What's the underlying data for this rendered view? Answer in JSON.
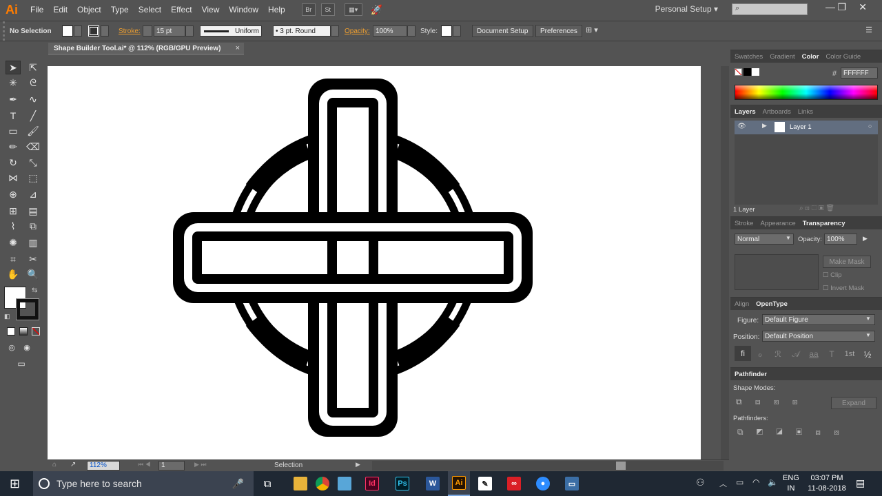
{
  "app": {
    "logo": "Ai",
    "menu": [
      "File",
      "Edit",
      "Object",
      "Type",
      "Select",
      "Effect",
      "View",
      "Window",
      "Help"
    ],
    "menubar_icons": [
      "Br",
      "St"
    ],
    "workspace": "Personal Setup",
    "search_placeholder": ""
  },
  "control_bar": {
    "selection": "No Selection",
    "stroke_label": "Stroke:",
    "stroke_weight": "15 pt",
    "stroke_profile": "Uniform",
    "brush": "3 pt. Round",
    "opacity_label": "Opacity:",
    "opacity": "100%",
    "style_label": "Style:",
    "document_setup": "Document Setup",
    "preferences": "Preferences"
  },
  "document": {
    "tab_title": "Shape Builder Tool.ai* @ 112% (RGB/GPU Preview)",
    "zoom": "112%",
    "artboard_number": "1",
    "status_tool": "Selection"
  },
  "panels": {
    "color": {
      "tabs": [
        "Swatches",
        "Gradient",
        "Color",
        "Color Guide"
      ],
      "active_tab": "Color",
      "hex_symbol": "#",
      "hex": "FFFFFF"
    },
    "layers": {
      "tabs": [
        "Layers",
        "Artboards",
        "Links"
      ],
      "layer_name": "Layer 1",
      "count": "1 Layer"
    },
    "transparency": {
      "tabs": [
        "Stroke",
        "Appearance",
        "Transparency"
      ],
      "blend_mode": "Normal",
      "opacity_label": "Opacity:",
      "opacity": "100%",
      "make_mask": "Make Mask",
      "clip": "Clip",
      "invert_mask": "Invert Mask"
    },
    "opentype": {
      "tabs": [
        "Align",
        "OpenType"
      ],
      "figure_label": "Figure:",
      "figure_value": "Default Figure",
      "position_label": "Position:",
      "position_value": "Default Position",
      "glyphs": [
        "ﬁ",
        "ℴ",
        "ℛ",
        "𝒜",
        "aa",
        "T",
        "1st",
        "½"
      ]
    },
    "pathfinder": {
      "title": "Pathfinder",
      "shape_modes_label": "Shape Modes:",
      "expand": "Expand",
      "pathfinders_label": "Pathfinders:"
    }
  },
  "taskbar": {
    "search_placeholder": "Type here to search",
    "apps": [
      {
        "name": "indesign",
        "label": "Id",
        "color": "#49021f",
        "fg": "#ff3366"
      },
      {
        "name": "photoshop",
        "label": "Ps",
        "color": "#001d26",
        "fg": "#31c5f0"
      },
      {
        "name": "word",
        "label": "W",
        "color": "#2b579a",
        "fg": "#ffffff"
      },
      {
        "name": "illustrator",
        "label": "Ai",
        "color": "#261300",
        "fg": "#ff9a00"
      }
    ],
    "lang_top": "ENG",
    "lang_bottom": "IN",
    "time": "03:07 PM",
    "date": "11-08-2018"
  },
  "colors": {
    "accent_orange": "#ff7c00",
    "ui_gray": "#535353",
    "taskbar": "#1f2833"
  }
}
